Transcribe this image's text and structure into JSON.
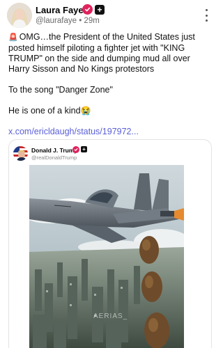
{
  "post": {
    "author_name": "Laura Faye",
    "handle": "@laurafaye",
    "separator": "•",
    "time": "29m",
    "body_paragraphs": [
      "OMG…the President of the United States just posted himself piloting a fighter jet with \"KING TRUMP\" on the side and dumping mud all over Harry Sisson and No Kings protestors",
      "To the song \"Danger Zone\"",
      "He is one of a kind"
    ],
    "link_text": "x.com/ericldaugh/status/197972..."
  },
  "embed": {
    "author_name": "Donald J. Trump",
    "handle": "@realDonaldTrump",
    "watermark": "AERIAS_"
  },
  "icons": {
    "verified": "verified-badge-icon",
    "plus": "plus-badge-icon",
    "more": "more-vertical-icon",
    "siren": "police-light-emoji",
    "cry": "loudly-crying-emoji"
  },
  "colors": {
    "link": "#5a5fd8",
    "verified": "#e0245e",
    "meta_text": "#6b6b6b"
  }
}
